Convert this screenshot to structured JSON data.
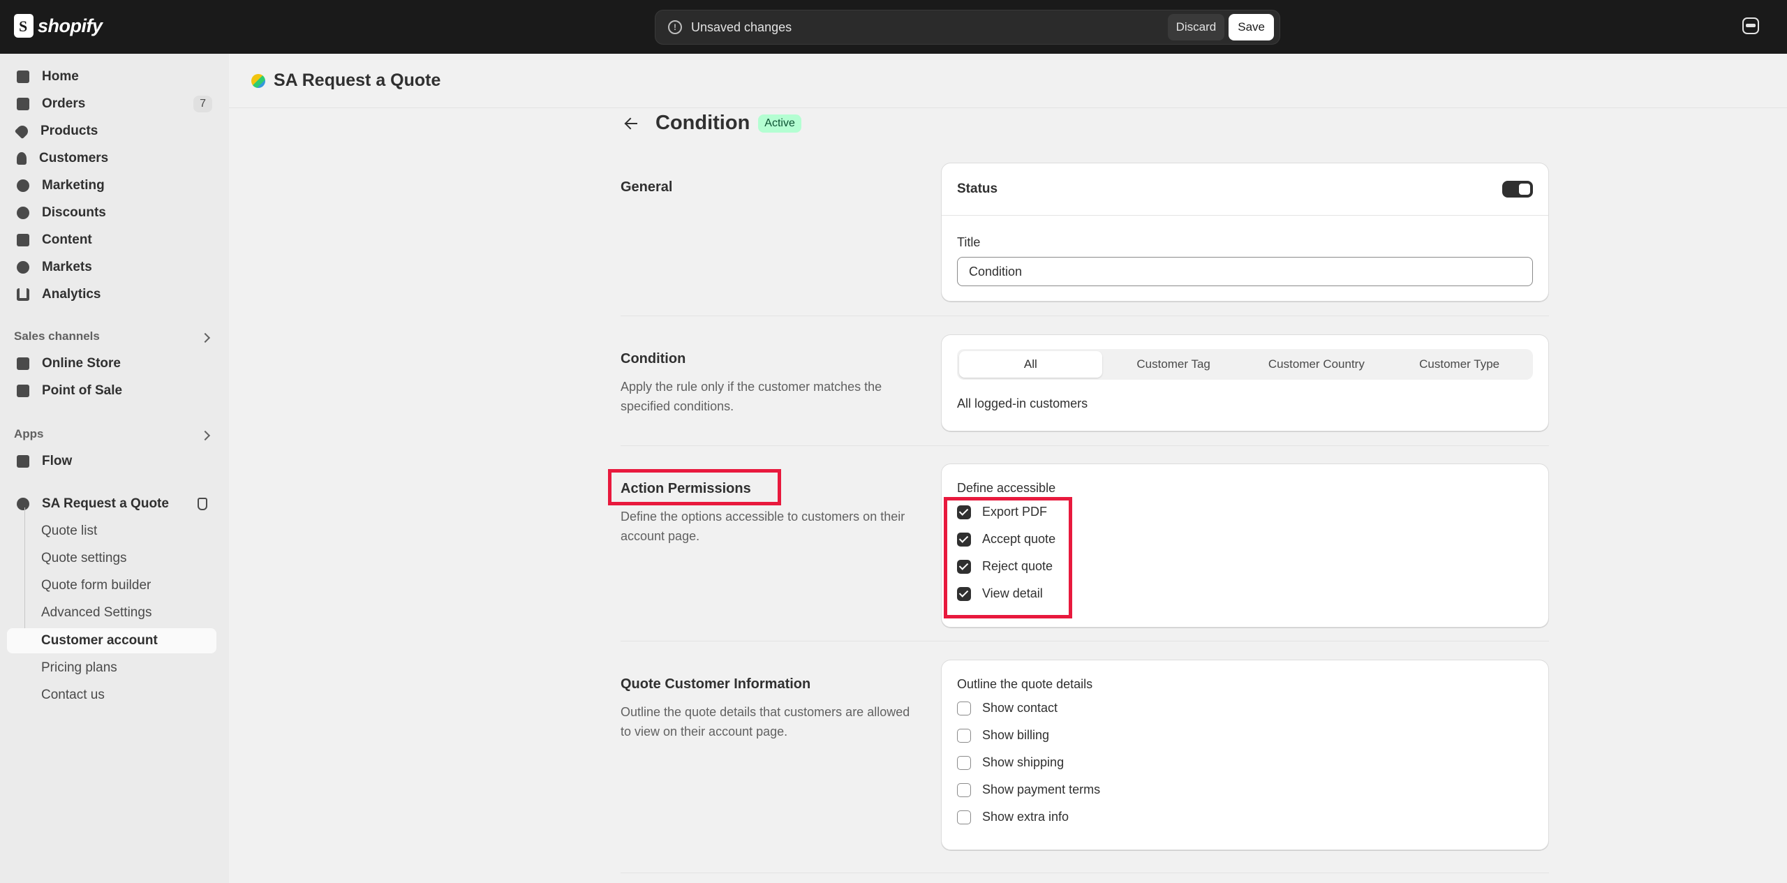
{
  "topbar": {
    "logo_text": "shopify",
    "unsaved_text": "Unsaved changes",
    "discard_label": "Discard",
    "save_label": "Save"
  },
  "sidebar": {
    "items": [
      {
        "label": "Home",
        "icon": "home-icon"
      },
      {
        "label": "Orders",
        "icon": "orders-icon",
        "badge": "7"
      },
      {
        "label": "Products",
        "icon": "tag-icon"
      },
      {
        "label": "Customers",
        "icon": "person-icon"
      },
      {
        "label": "Marketing",
        "icon": "target-icon"
      },
      {
        "label": "Discounts",
        "icon": "discount-icon"
      },
      {
        "label": "Content",
        "icon": "content-icon"
      },
      {
        "label": "Markets",
        "icon": "globe-icon"
      },
      {
        "label": "Analytics",
        "icon": "bar-chart-icon"
      }
    ],
    "sales_channels_heading": "Sales channels",
    "sales_channels": [
      {
        "label": "Online Store",
        "icon": "store-icon"
      },
      {
        "label": "Point of Sale",
        "icon": "pos-icon"
      }
    ],
    "apps_heading": "Apps",
    "apps": [
      {
        "label": "Flow",
        "icon": "flow-icon"
      }
    ],
    "app_name": "SA Request a Quote",
    "app_subitems": [
      {
        "label": "Quote list"
      },
      {
        "label": "Quote settings"
      },
      {
        "label": "Quote form builder"
      },
      {
        "label": "Advanced Settings"
      },
      {
        "label": "Customer account",
        "active": true
      },
      {
        "label": "Pricing plans"
      },
      {
        "label": "Contact us"
      }
    ]
  },
  "header": {
    "app_title": "SA Request a Quote"
  },
  "page": {
    "title": "Condition",
    "status": "Active"
  },
  "general": {
    "title": "General",
    "status_label": "Status",
    "status_on": true,
    "title_field_label": "Title",
    "title_field_value": "Condition"
  },
  "condition": {
    "title": "Condition",
    "description": "Apply the rule only if the customer matches the specified conditions.",
    "tabs": [
      "All",
      "Customer Tag",
      "Customer Country",
      "Customer Type"
    ],
    "selected_tab": "All",
    "summary": "All logged-in customers"
  },
  "action_permissions": {
    "title": "Action Permissions",
    "description": "Define the options accessible to customers on their account page.",
    "subtitle": "Define accessible",
    "options": [
      {
        "label": "Export PDF",
        "checked": true
      },
      {
        "label": "Accept quote",
        "checked": true
      },
      {
        "label": "Reject quote",
        "checked": true
      },
      {
        "label": "View detail",
        "checked": true
      }
    ]
  },
  "quote_info": {
    "title": "Quote Customer Information",
    "description": "Outline the quote details that customers are allowed to view on their account page.",
    "subtitle": "Outline the quote details",
    "options": [
      {
        "label": "Show contact",
        "checked": false
      },
      {
        "label": "Show billing",
        "checked": false
      },
      {
        "label": "Show shipping",
        "checked": false
      },
      {
        "label": "Show payment terms",
        "checked": false
      },
      {
        "label": "Show extra info",
        "checked": false
      }
    ]
  },
  "colors": {
    "highlight": "#e8193d",
    "active_badge_bg": "#b4fed2"
  }
}
